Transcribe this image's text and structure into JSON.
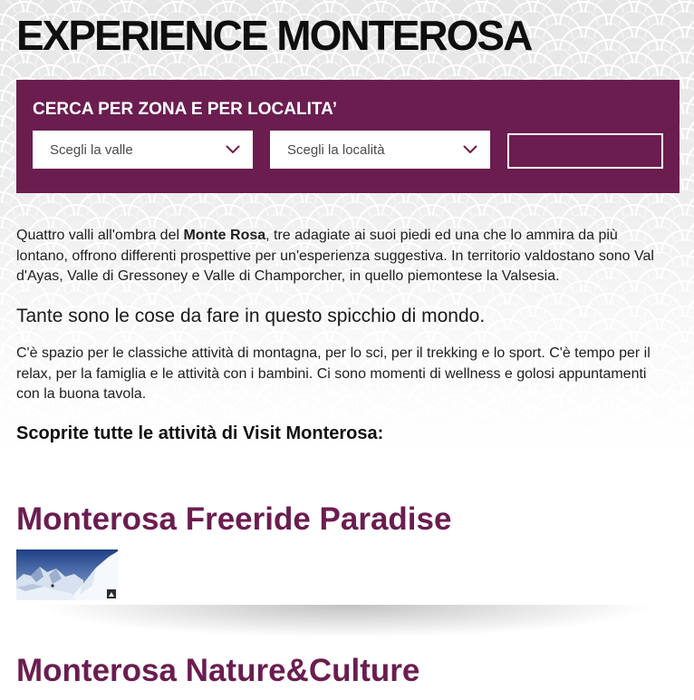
{
  "page": {
    "title": "EXPERIENCE MONTEROSA"
  },
  "search": {
    "heading": "CERCA PER ZONA E PER LOCALITA’",
    "valley_select": {
      "value": "Scegli la valle",
      "icon": "chevron-down-icon"
    },
    "locality_select": {
      "value": "Scegli la località",
      "icon": "chevron-down-icon"
    }
  },
  "intro": {
    "paragraph_1": {
      "before": "Quattro valli all'ombra del ",
      "bold": "Monte Rosa",
      "after": ", tre adagiate ai suoi piedi ed una che lo ammira da più lontano, offrono differenti prospettive per un'esperienza suggestiva. In territorio valdostano sono Val d'Ayas, Valle di Gressoney e Valle di Champorcher, in quello piemontese la Valsesia."
    },
    "lead": "Tante sono le cose da fare in questo spicchio di mondo.",
    "paragraph_2": "C'è spazio per le classiche attività di montagna, per lo sci, per il trekking e lo sport. C'è tempo per il relax, per la famiglia e le attività con i bambini. Ci sono momenti di wellness e golosi appuntamenti con la buona tavola.",
    "cta": "Scoprite tutte le attività di Visit Monterosa:"
  },
  "activities": [
    {
      "title": "Monterosa Freeride Paradise"
    },
    {
      "title": "Monterosa Nature&Culture"
    }
  ],
  "colors": {
    "brand_purple": "#6b1d50",
    "panel_text": "#ffffff",
    "body_text": "#1f1f1f",
    "background_pattern": "#e6e6e6"
  }
}
